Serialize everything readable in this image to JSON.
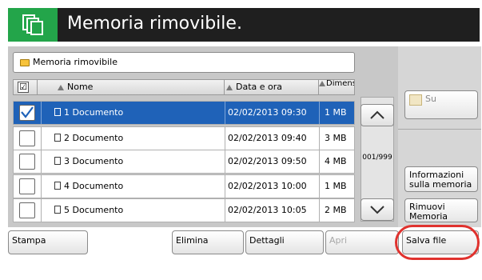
{
  "header": {
    "title": "Memoria rimovibile."
  },
  "path": {
    "label": "Memoria rimovibile"
  },
  "table": {
    "columns": {
      "name": "Nome",
      "datetime": "Data e ora",
      "size": "Dimensio ni"
    },
    "rows": [
      {
        "name": "1  Documento",
        "datetime": "02/02/2013 09:30",
        "size": "1 MB",
        "checked": true,
        "selected": true
      },
      {
        "name": "2  Documento",
        "datetime": "02/02/2013 09:40",
        "size": "3 MB",
        "checked": false,
        "selected": false
      },
      {
        "name": "3  Documento",
        "datetime": "02/02/2013 09:50",
        "size": "4 MB",
        "checked": false,
        "selected": false
      },
      {
        "name": "4  Documento",
        "datetime": "02/02/2013 10:00",
        "size": "1 MB",
        "checked": false,
        "selected": false
      },
      {
        "name": "5  Documento",
        "datetime": "02/02/2013 10:05",
        "size": "2 MB",
        "checked": false,
        "selected": false
      }
    ]
  },
  "pager": {
    "indicator": "001/999"
  },
  "right": {
    "up_label": "Su",
    "memory_info_label": "Informazioni sulla memoria",
    "remove_memory_label": "Rimuovi Memoria"
  },
  "bottom": {
    "print_label": "Stampa",
    "delete_label": "Elimina",
    "details_label": "Dettagli",
    "open_label": "Apri",
    "save_file_label": "Salva file"
  },
  "colors": {
    "header_bg": "#1f1f1f",
    "logo_bg": "#23a54a",
    "selected_row": "#1f62b8",
    "highlight": "#e0322e"
  }
}
